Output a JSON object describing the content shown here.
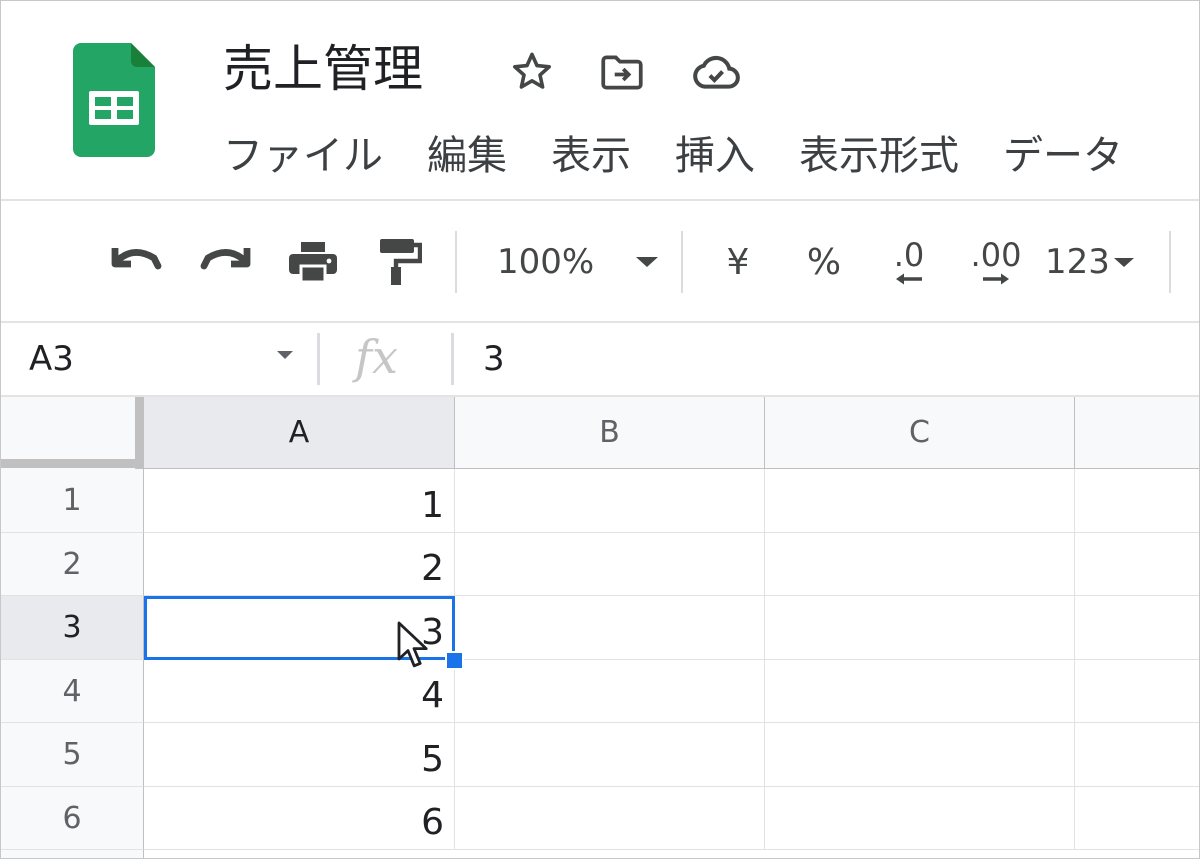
{
  "document": {
    "title": "売上管理"
  },
  "menu": [
    "ファイル",
    "編集",
    "表示",
    "挿入",
    "表示形式",
    "データ"
  ],
  "toolbar": {
    "zoom": "100%",
    "currency": "¥",
    "percent": "%",
    "decrease_decimal": ".0",
    "increase_decimal": ".00",
    "more_formats": "123",
    "icons": [
      "undo-icon",
      "redo-icon",
      "print-icon",
      "paint-format-icon"
    ]
  },
  "formula_bar": {
    "name_box": "A3",
    "fx": "fx",
    "value": "3"
  },
  "grid": {
    "columns": [
      "A",
      "B",
      "C"
    ],
    "rows": [
      {
        "row": "1",
        "cells": [
          "1",
          "",
          ""
        ]
      },
      {
        "row": "2",
        "cells": [
          "2",
          "",
          ""
        ]
      },
      {
        "row": "3",
        "cells": [
          "3",
          "",
          ""
        ]
      },
      {
        "row": "4",
        "cells": [
          "4",
          "",
          ""
        ]
      },
      {
        "row": "5",
        "cells": [
          "5",
          "",
          ""
        ]
      },
      {
        "row": "6",
        "cells": [
          "6",
          "",
          ""
        ]
      }
    ],
    "selected_cell": "A3"
  },
  "colors": {
    "accent": "#1a73e8",
    "sheets_green": "#23a566"
  }
}
